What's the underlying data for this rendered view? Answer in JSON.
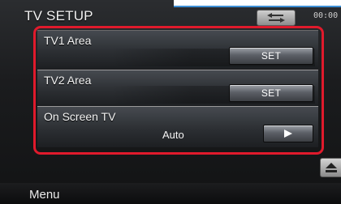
{
  "header": {
    "title": "TV SETUP",
    "clock": "00:00",
    "back_icon": "back-arrow-icon"
  },
  "settings": {
    "rows": [
      {
        "label": "TV1 Area",
        "button_label": "SET"
      },
      {
        "label": "TV2 Area",
        "button_label": "SET"
      },
      {
        "label": "On Screen TV",
        "value": "Auto",
        "button_icon": "play-right-icon"
      }
    ]
  },
  "side": {
    "icon": "eject-icon"
  },
  "footer": {
    "menu_label": "Menu"
  },
  "colors": {
    "highlight_frame": "#e01a2c",
    "accent_line": "#3e8fd6"
  }
}
